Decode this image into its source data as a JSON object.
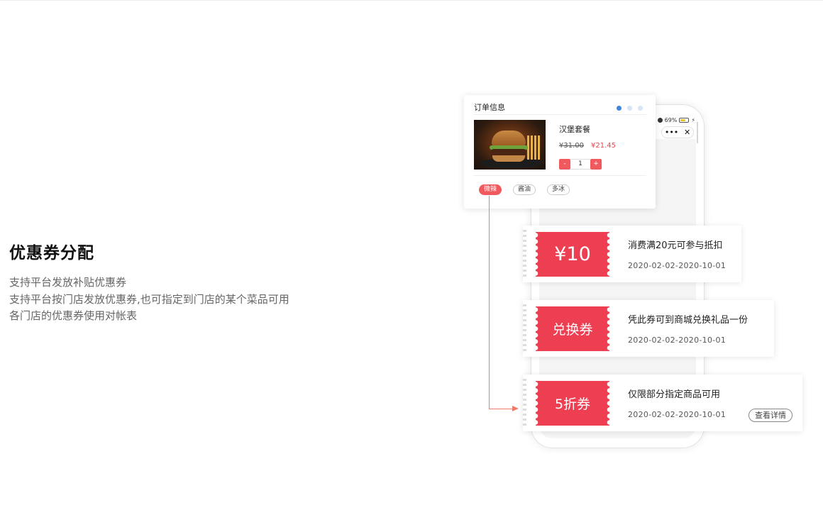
{
  "feature": {
    "title": "优惠券分配",
    "lines": [
      "支持平台发放补贴优惠券",
      "支持平台按门店发放优惠券,也可指定到门店的某个菜品可用",
      "各门店的优惠券使用对帐表"
    ]
  },
  "phone": {
    "battery": "69%",
    "capsule_more": "•••",
    "capsule_close": "✕"
  },
  "order": {
    "title": "订单信息",
    "product_name": "汉堡套餐",
    "price_old": "¥31.00",
    "price_new": "¥21.45",
    "quantity": "1",
    "minus": "-",
    "plus": "+",
    "tags": [
      "微辣",
      "酱油",
      "多冰"
    ],
    "active_tag": "微辣"
  },
  "coupons": [
    {
      "stub": "¥10",
      "desc": "消费满20元可参与抵扣",
      "date": "2020-02-02-2020-10-01"
    },
    {
      "stub": "兑换券",
      "desc": "凭此券可到商城兑换礼品一份",
      "date": "2020-02-02-2020-10-01"
    },
    {
      "stub": "5折券",
      "desc": "仅限部分指定商品可用",
      "date": "2020-02-02-2020-10-01",
      "action": "查看详情"
    }
  ],
  "colors": {
    "accent_red": "#ee3e52",
    "tag_red": "#f05a5f",
    "connector": "#f07a6b",
    "dot_active": "#3f85e0"
  }
}
